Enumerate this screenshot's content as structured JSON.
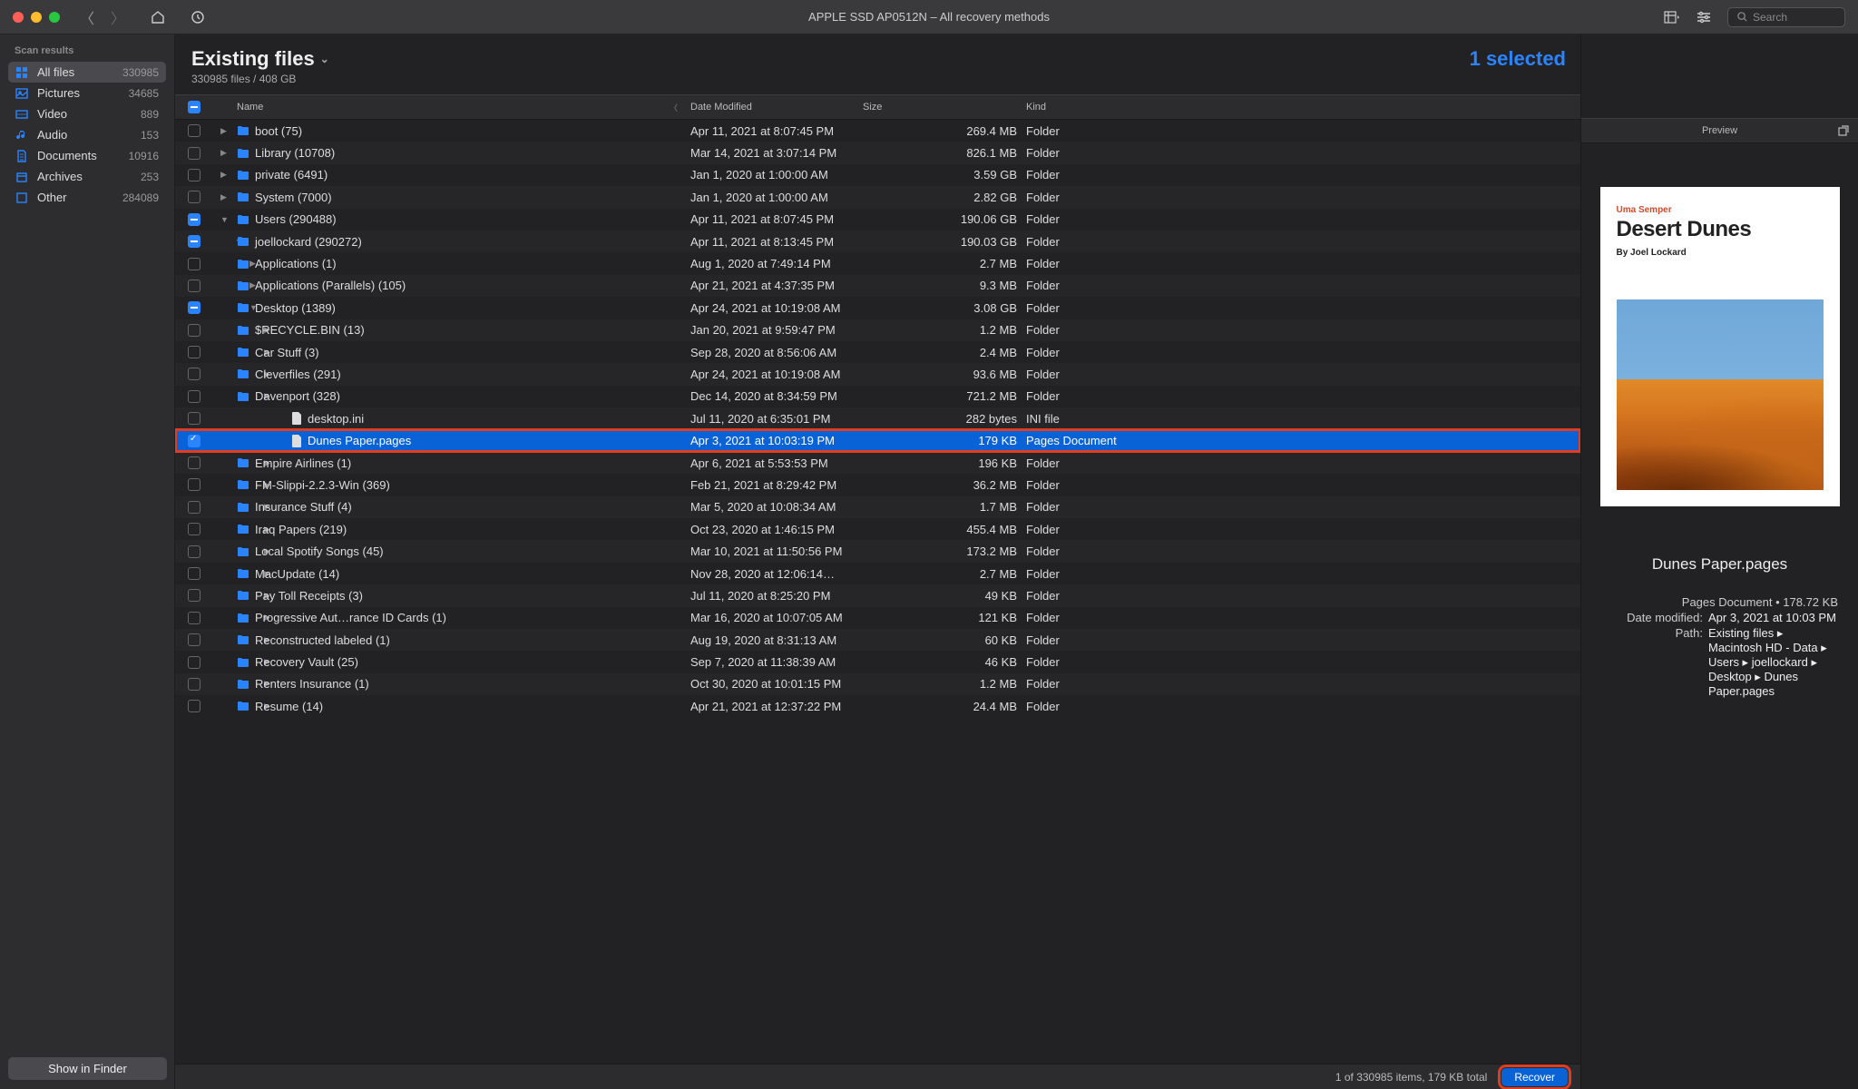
{
  "titlebar": {
    "title": "APPLE SSD AP0512N – All recovery methods",
    "search_placeholder": "Search"
  },
  "sidebar": {
    "header": "Scan results",
    "items": [
      {
        "icon": "grid",
        "label": "All files",
        "count": "330985",
        "active": true
      },
      {
        "icon": "image",
        "label": "Pictures",
        "count": "34685"
      },
      {
        "icon": "video",
        "label": "Video",
        "count": "889"
      },
      {
        "icon": "audio",
        "label": "Audio",
        "count": "153"
      },
      {
        "icon": "doc",
        "label": "Documents",
        "count": "10916"
      },
      {
        "icon": "archive",
        "label": "Archives",
        "count": "253"
      },
      {
        "icon": "other",
        "label": "Other",
        "count": "284089"
      }
    ],
    "show_finder": "Show in Finder"
  },
  "center": {
    "title": "Existing files",
    "subtitle": "330985 files / 408 GB",
    "selected_badge": "1 selected",
    "columns": {
      "name": "Name",
      "date": "Date Modified",
      "size": "Size",
      "kind": "Kind"
    },
    "status": "1 of 330985 items, 179 KB total",
    "recover": "Recover"
  },
  "rows": [
    {
      "indent": 0,
      "cb": "",
      "arrow": "▶",
      "icon": "folder",
      "name": "boot (75)",
      "date": "Apr 11, 2021 at 8:07:45 PM",
      "size": "269.4 MB",
      "kind": "Folder"
    },
    {
      "indent": 0,
      "cb": "",
      "arrow": "▶",
      "icon": "folder",
      "name": "Library (10708)",
      "date": "Mar 14, 2021 at 3:07:14 PM",
      "size": "826.1 MB",
      "kind": "Folder"
    },
    {
      "indent": 0,
      "cb": "",
      "arrow": "▶",
      "icon": "folder",
      "name": "private (6491)",
      "date": "Jan 1, 2020 at 1:00:00 AM",
      "size": "3.59 GB",
      "kind": "Folder"
    },
    {
      "indent": 0,
      "cb": "",
      "arrow": "▶",
      "icon": "folder",
      "name": "System (7000)",
      "date": "Jan 1, 2020 at 1:00:00 AM",
      "size": "2.82 GB",
      "kind": "Folder"
    },
    {
      "indent": 0,
      "cb": "ind",
      "arrow": "▼",
      "icon": "folder",
      "name": "Users (290488)",
      "date": "Apr 11, 2021 at 8:07:45 PM",
      "size": "190.06 GB",
      "kind": "Folder"
    },
    {
      "indent": 1,
      "cb": "ind",
      "arrow": "▼",
      "icon": "folder",
      "name": "joellockard (290272)",
      "date": "Apr 11, 2021 at 8:13:45 PM",
      "size": "190.03 GB",
      "kind": "Folder"
    },
    {
      "indent": 2,
      "cb": "",
      "arrow": "▶",
      "icon": "folder",
      "name": "Applications (1)",
      "date": "Aug 1, 2020 at 7:49:14 PM",
      "size": "2.7 MB",
      "kind": "Folder"
    },
    {
      "indent": 2,
      "cb": "",
      "arrow": "▶",
      "icon": "folder",
      "name": "Applications (Parallels) (105)",
      "date": "Apr 21, 2021 at 4:37:35 PM",
      "size": "9.3 MB",
      "kind": "Folder"
    },
    {
      "indent": 2,
      "cb": "ind",
      "arrow": "▼",
      "icon": "folder",
      "name": "Desktop (1389)",
      "date": "Apr 24, 2021 at 10:19:08 AM",
      "size": "3.08 GB",
      "kind": "Folder"
    },
    {
      "indent": 3,
      "cb": "",
      "arrow": "▶",
      "icon": "folder",
      "name": "$RECYCLE.BIN (13)",
      "date": "Jan 20, 2021 at 9:59:47 PM",
      "size": "1.2 MB",
      "kind": "Folder"
    },
    {
      "indent": 3,
      "cb": "",
      "arrow": "▶",
      "icon": "folder",
      "name": "Car Stuff (3)",
      "date": "Sep 28, 2020 at 8:56:06 AM",
      "size": "2.4 MB",
      "kind": "Folder"
    },
    {
      "indent": 3,
      "cb": "",
      "arrow": "▶",
      "icon": "folder",
      "name": "Cleverfiles (291)",
      "date": "Apr 24, 2021 at 10:19:08 AM",
      "size": "93.6 MB",
      "kind": "Folder"
    },
    {
      "indent": 3,
      "cb": "",
      "arrow": "▶",
      "icon": "folder",
      "name": "Davenport (328)",
      "date": "Dec 14, 2020 at 8:34:59 PM",
      "size": "721.2 MB",
      "kind": "Folder"
    },
    {
      "indent": 3,
      "cb": "",
      "arrow": "",
      "icon": "file",
      "name": "desktop.ini",
      "date": "Jul 11, 2020 at 6:35:01 PM",
      "size": "282 bytes",
      "kind": "INI file"
    },
    {
      "indent": 3,
      "cb": "chk",
      "arrow": "",
      "icon": "file",
      "name": "Dunes Paper.pages",
      "date": "Apr 3, 2021 at 10:03:19 PM",
      "size": "179 KB",
      "kind": "Pages Document",
      "selected": true,
      "highlight": true
    },
    {
      "indent": 3,
      "cb": "",
      "arrow": "▶",
      "icon": "folder",
      "name": "Empire Airlines (1)",
      "date": "Apr 6, 2021 at 5:53:53 PM",
      "size": "196 KB",
      "kind": "Folder"
    },
    {
      "indent": 3,
      "cb": "",
      "arrow": "▶",
      "icon": "folder",
      "name": "FM-Slippi-2.2.3-Win (369)",
      "date": "Feb 21, 2021 at 8:29:42 PM",
      "size": "36.2 MB",
      "kind": "Folder"
    },
    {
      "indent": 3,
      "cb": "",
      "arrow": "▶",
      "icon": "folder",
      "name": "Insurance Stuff (4)",
      "date": "Mar 5, 2020 at 10:08:34 AM",
      "size": "1.7 MB",
      "kind": "Folder"
    },
    {
      "indent": 3,
      "cb": "",
      "arrow": "▶",
      "icon": "folder",
      "name": "Iraq Papers (219)",
      "date": "Oct 23, 2020 at 1:46:15 PM",
      "size": "455.4 MB",
      "kind": "Folder"
    },
    {
      "indent": 3,
      "cb": "",
      "arrow": "▶",
      "icon": "folder",
      "name": "Local Spotify Songs (45)",
      "date": "Mar 10, 2021 at 11:50:56 PM",
      "size": "173.2 MB",
      "kind": "Folder"
    },
    {
      "indent": 3,
      "cb": "",
      "arrow": "▶",
      "icon": "folder",
      "name": "MacUpdate (14)",
      "date": "Nov 28, 2020 at 12:06:14…",
      "size": "2.7 MB",
      "kind": "Folder"
    },
    {
      "indent": 3,
      "cb": "",
      "arrow": "▶",
      "icon": "folder",
      "name": "Pay Toll Receipts (3)",
      "date": "Jul 11, 2020 at 8:25:20 PM",
      "size": "49 KB",
      "kind": "Folder"
    },
    {
      "indent": 3,
      "cb": "",
      "arrow": "▶",
      "icon": "folder",
      "name": "Progressive Aut…rance ID Cards (1)",
      "date": "Mar 16, 2020 at 10:07:05 AM",
      "size": "121 KB",
      "kind": "Folder"
    },
    {
      "indent": 3,
      "cb": "",
      "arrow": "▶",
      "icon": "folder",
      "name": "Reconstructed labeled (1)",
      "date": "Aug 19, 2020 at 8:31:13 AM",
      "size": "60 KB",
      "kind": "Folder"
    },
    {
      "indent": 3,
      "cb": "",
      "arrow": "▶",
      "icon": "folder",
      "name": "Recovery Vault (25)",
      "date": "Sep 7, 2020 at 11:38:39 AM",
      "size": "46 KB",
      "kind": "Folder"
    },
    {
      "indent": 3,
      "cb": "",
      "arrow": "▶",
      "icon": "folder",
      "name": "Renters Insurance (1)",
      "date": "Oct 30, 2020 at 10:01:15 PM",
      "size": "1.2 MB",
      "kind": "Folder"
    },
    {
      "indent": 3,
      "cb": "",
      "arrow": "▶",
      "icon": "folder",
      "name": "Resume (14)",
      "date": "Apr 21, 2021 at 12:37:22 PM",
      "size": "24.4 MB",
      "kind": "Folder"
    }
  ],
  "preview": {
    "header": "Preview",
    "doc": {
      "small": "Uma Semper",
      "title": "Desert Dunes",
      "by": "By Joel Lockard"
    },
    "filename": "Dunes Paper.pages",
    "kind_line": "Pages Document  •  178.72 KB",
    "date_label": "Date modified:",
    "date_value": "Apr 3, 2021 at 10:03 PM",
    "path_label": "Path:",
    "path_value": "Existing files ▸ Macintosh HD - Data ▸ Users ▸ joellockard ▸ Desktop ▸ Dunes Paper.pages"
  }
}
